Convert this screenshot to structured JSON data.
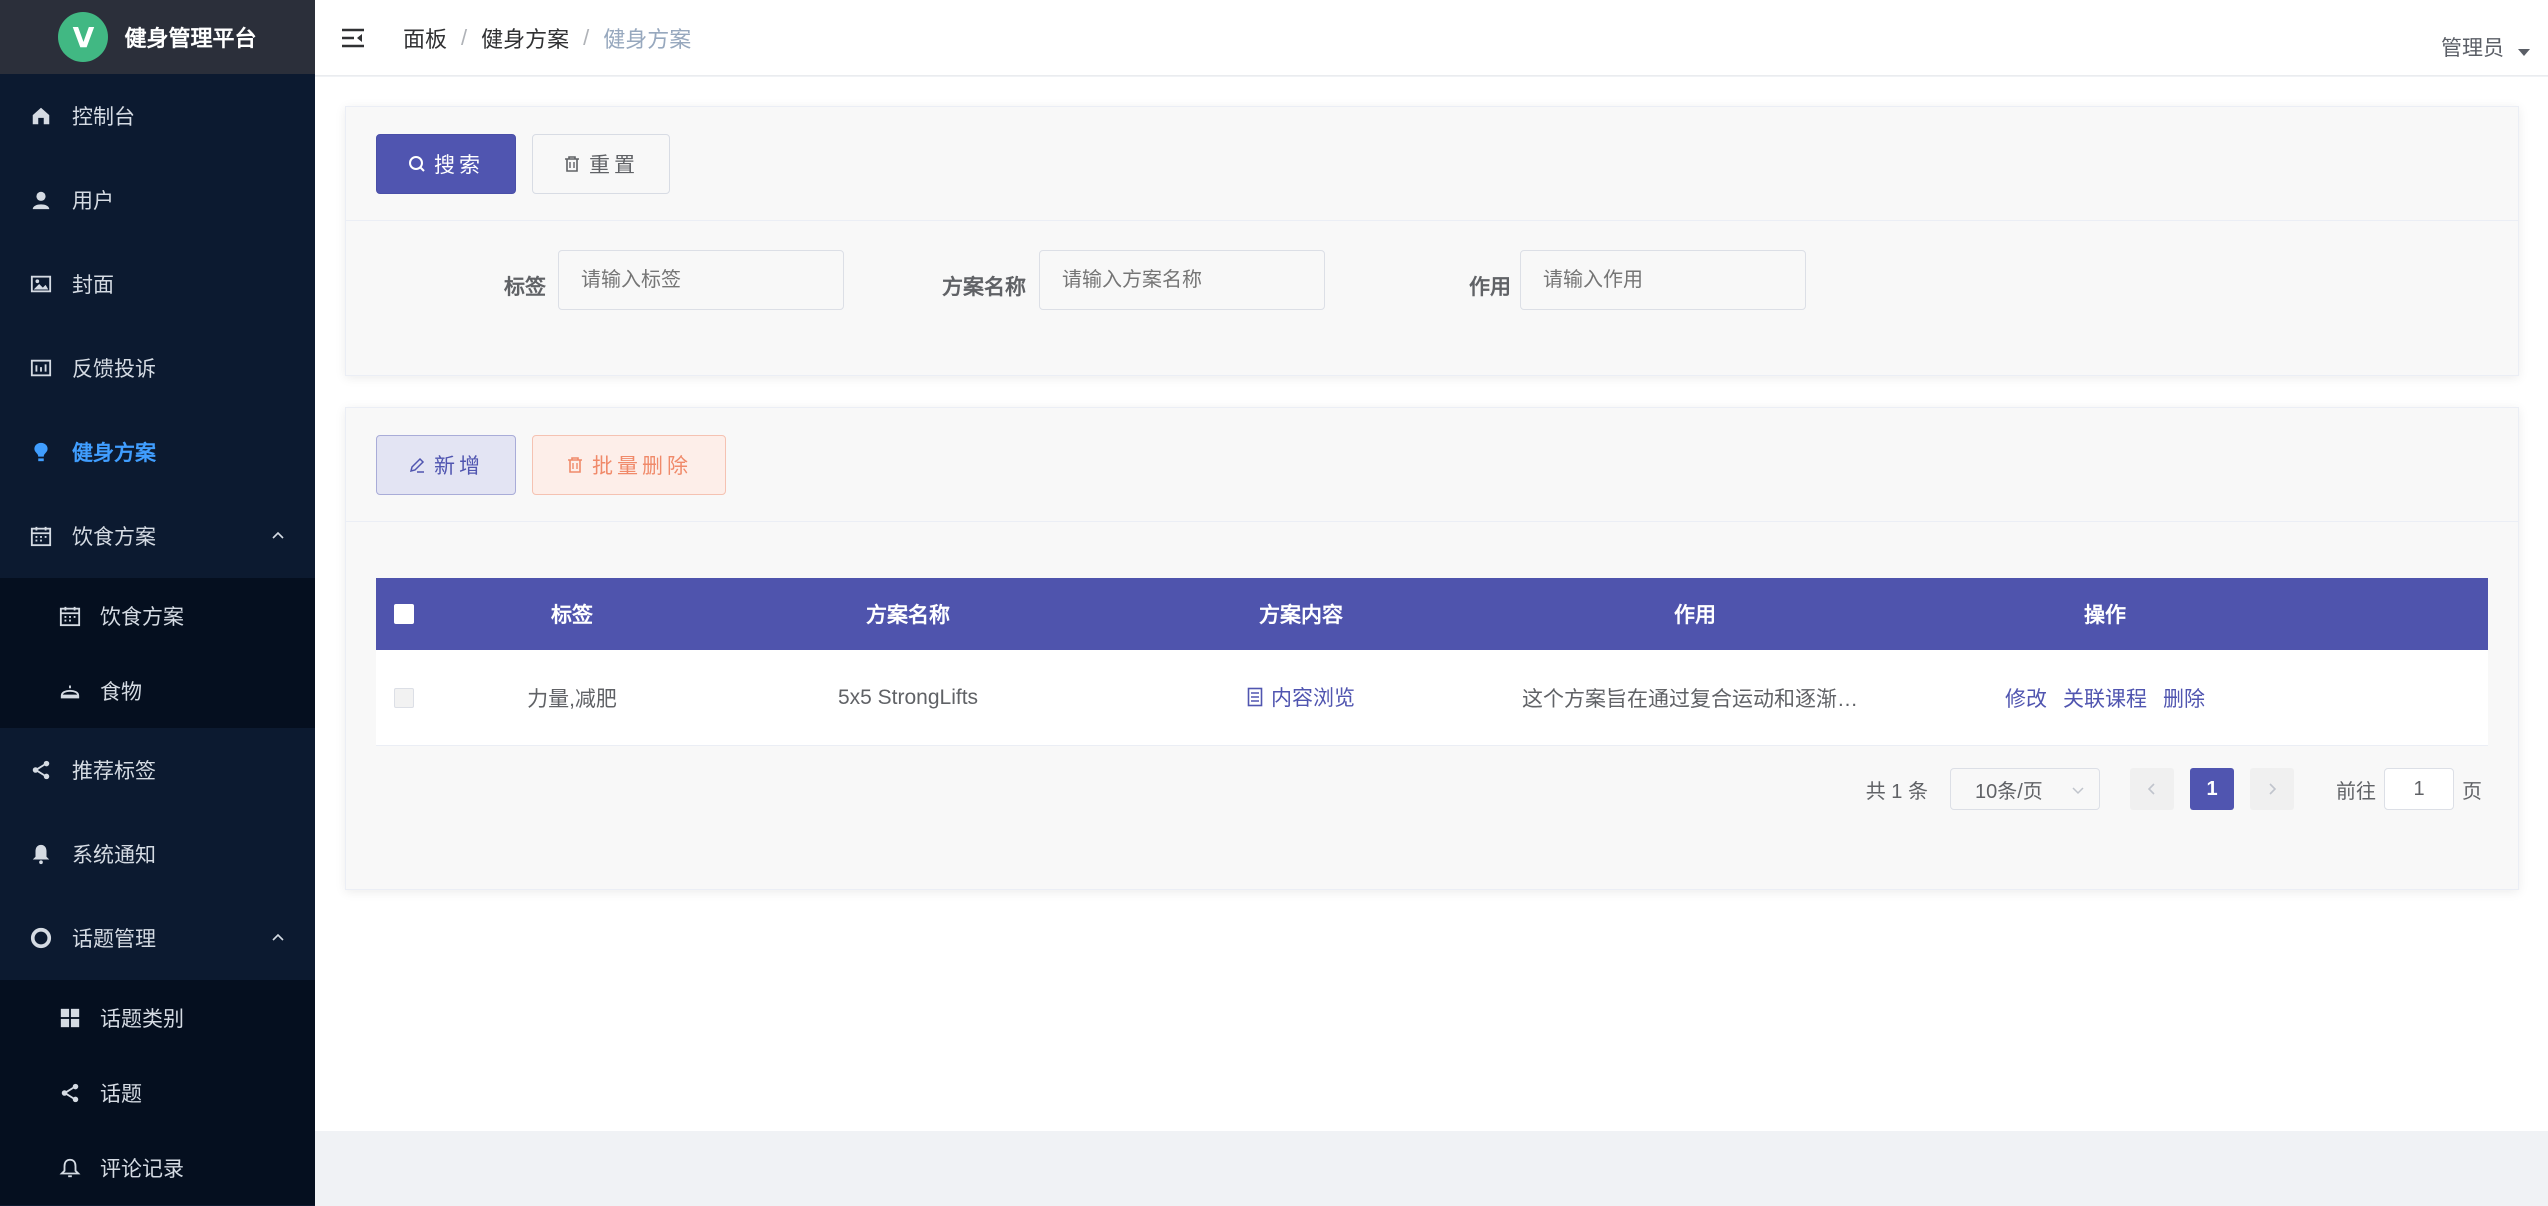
{
  "brand": {
    "logo_letter": "V",
    "title": "健身管理平台"
  },
  "sidebar": {
    "items": [
      {
        "label": "控制台",
        "icon": "home-icon"
      },
      {
        "label": "用户",
        "icon": "user-icon"
      },
      {
        "label": "封面",
        "icon": "picture-icon"
      },
      {
        "label": "反馈投诉",
        "icon": "data-board-icon"
      },
      {
        "label": "健身方案",
        "icon": "bulb-icon",
        "active": true
      },
      {
        "label": "饮食方案",
        "icon": "calendar-icon",
        "expanded": true
      },
      {
        "label": "推荐标签",
        "icon": "share-icon"
      },
      {
        "label": "系统通知",
        "icon": "bell-icon"
      },
      {
        "label": "话题管理",
        "icon": "help-icon",
        "expanded": true
      }
    ],
    "diet_sub": [
      {
        "label": "饮食方案",
        "icon": "calendar-icon"
      },
      {
        "label": "食物",
        "icon": "food-cover-icon"
      }
    ],
    "topic_sub": [
      {
        "label": "话题类别",
        "icon": "grid-icon"
      },
      {
        "label": "话题",
        "icon": "share-icon"
      },
      {
        "label": "评论记录",
        "icon": "bell-outline-icon"
      }
    ]
  },
  "header": {
    "breadcrumb": [
      "面板",
      "健身方案",
      "健身方案"
    ],
    "user": "管理员"
  },
  "search_card": {
    "search_button": "搜索",
    "reset_button": "重置",
    "filters": [
      {
        "label": "标签",
        "placeholder": "请输入标签"
      },
      {
        "label": "方案名称",
        "placeholder": "请输入方案名称"
      },
      {
        "label": "作用",
        "placeholder": "请输入作用"
      }
    ]
  },
  "table_card": {
    "add_button": "新增",
    "batch_delete_button": "批量删除",
    "columns": [
      "标签",
      "方案名称",
      "方案内容",
      "作用",
      "操作"
    ],
    "rows": [
      {
        "tags": "力量,减肥",
        "name": "5x5 StrongLifts",
        "content_link": "内容浏览",
        "effect": "这个方案旨在通过复合运动和逐渐增...",
        "actions": [
          "修改",
          "关联课程",
          "删除"
        ]
      }
    ]
  },
  "pagination": {
    "total_text": "共 1 条",
    "page_size": "10条/页",
    "current_page": "1",
    "goto_label": "前往",
    "goto_value": "1",
    "page_suffix": "页"
  },
  "colors": {
    "sidebar_bg": "#0c1a30",
    "accent": "#5055b0",
    "active_menu": "#409eff",
    "danger_light": "#f08a6a"
  }
}
